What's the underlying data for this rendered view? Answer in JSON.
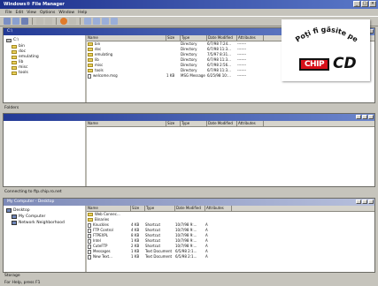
{
  "window": {
    "title": "Windows® File Manager"
  },
  "menu": [
    "File",
    "Edit",
    "View",
    "Options",
    "Window",
    "Help"
  ],
  "columns": [
    "Name",
    "Size",
    "Type",
    "Date Modified",
    "Attributes"
  ],
  "pane1": {
    "title": "C:\\",
    "tree": [
      "C:\\",
      "bin",
      "doc",
      "emulating",
      "lib",
      "misc",
      "tools"
    ],
    "files": [
      {
        "name": "bin",
        "size": "",
        "type": "Directory",
        "date": "6/7/98 7:24...",
        "attr": "-------"
      },
      {
        "name": "doc",
        "size": "",
        "type": "Directory",
        "date": "6/7/98 11:3...",
        "attr": "-------"
      },
      {
        "name": "emulating",
        "size": "",
        "type": "Directory",
        "date": "7/5/97 8:31...",
        "attr": "-------"
      },
      {
        "name": "lib",
        "size": "",
        "type": "Directory",
        "date": "6/7/98 11:3...",
        "attr": "-------"
      },
      {
        "name": "misc",
        "size": "",
        "type": "Directory",
        "date": "6/7/98 2:56...",
        "attr": "-------"
      },
      {
        "name": "tools",
        "size": "",
        "type": "Directory",
        "date": "6/7/98 11:3...",
        "attr": "-------"
      },
      {
        "name": "welcome.msg",
        "size": "1 KB",
        "type": "MSG Message",
        "date": "6/25/98 10:...",
        "attr": "-------"
      }
    ],
    "status": "Folders"
  },
  "pane2": {
    "title": "",
    "status": "Connecting to ftp.chip.ro.net"
  },
  "pane3": {
    "title": "My Computer - Desktop",
    "tree": [
      "Desktop",
      "My Computer",
      "Network Neighborhood"
    ],
    "files": [
      {
        "name": "Web Connec...",
        "size": "",
        "type": "",
        "date": "",
        "attr": ""
      },
      {
        "name": "Binaries",
        "size": "",
        "type": "",
        "date": "",
        "attr": ""
      },
      {
        "name": "Knuckles",
        "size": "4 KB",
        "type": "Shortcut",
        "date": "10/7/98 9:...",
        "attr": "A"
      },
      {
        "name": "FTP Control",
        "size": "4 KB",
        "type": "Shortcut",
        "date": "10/7/98 9:...",
        "attr": "A"
      },
      {
        "name": "FTPEXPL",
        "size": "8 KB",
        "type": "Shortcut",
        "date": "10/7/98 9:...",
        "attr": "A"
      },
      {
        "name": "Intel",
        "size": "1 KB",
        "type": "Shortcut",
        "date": "10/7/98 9:...",
        "attr": "A"
      },
      {
        "name": "CuteFTP",
        "size": "2 KB",
        "type": "Shortcut",
        "date": "10/7/98 9:...",
        "attr": "A"
      },
      {
        "name": "Messages",
        "size": "1 KB",
        "type": "Text Document",
        "date": "6/5/98 2:1...",
        "attr": "A"
      },
      {
        "name": "New Text...",
        "size": "1 KB",
        "type": "Text Document",
        "date": "6/5/98 2:1...",
        "attr": "A"
      }
    ],
    "status": "Storage"
  },
  "statusbar": "For Help, press F1",
  "ad": {
    "arc_text": "Poţi fi găsite pe",
    "chip": "CHIP",
    "cd": "CD"
  },
  "colors": {
    "titlebar": "#1c2f8c",
    "chip_red": "#d8101a",
    "folder": "#e9cf5a"
  }
}
